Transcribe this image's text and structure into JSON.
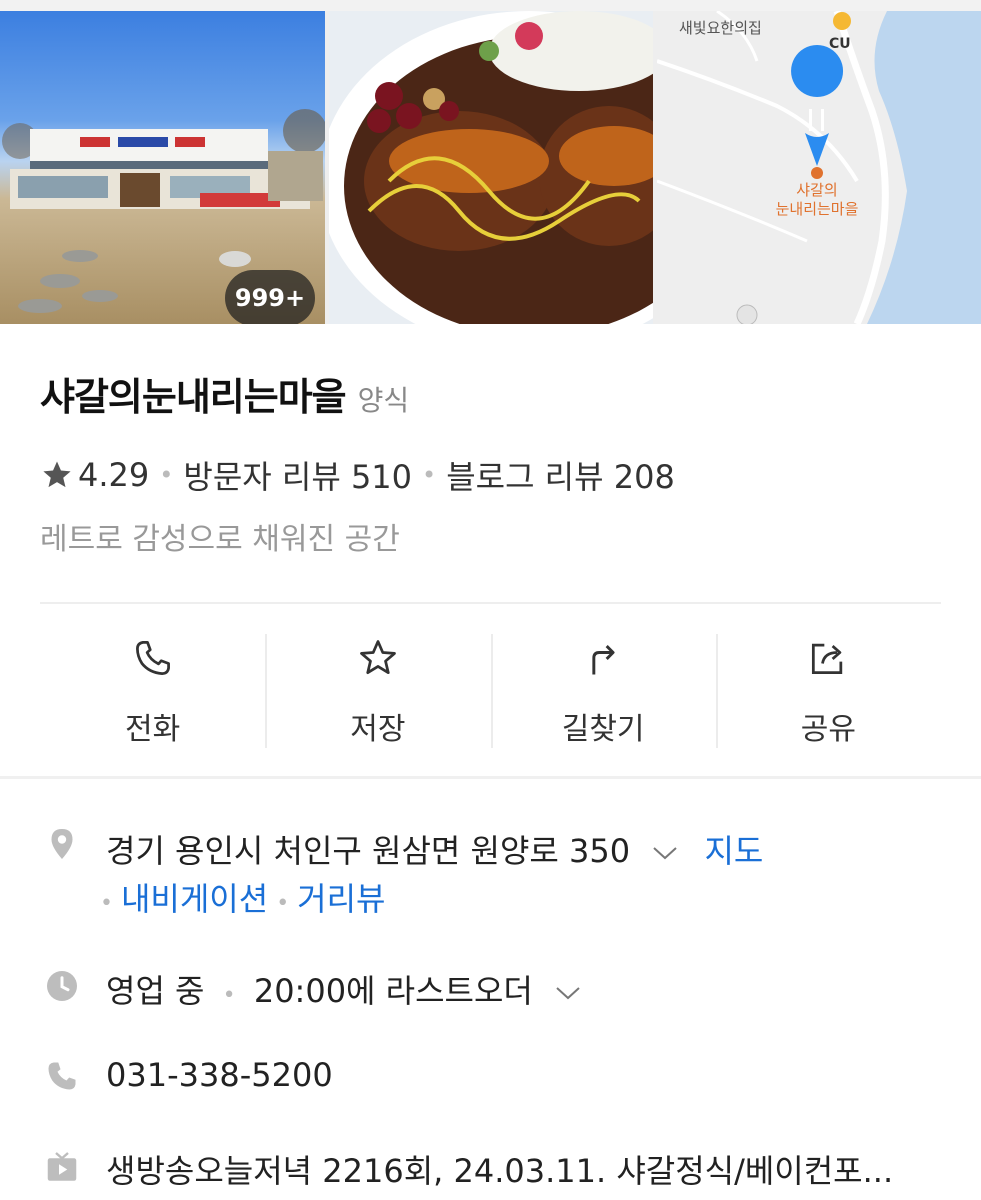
{
  "photos": {
    "count_badge": "999+",
    "map": {
      "label_top": "새빛요한의집",
      "cu_label": "CU",
      "place_label_line1": "샤갈의",
      "place_label_line2": "눈내리는마을"
    }
  },
  "place": {
    "name": "샤갈의눈내리는마을",
    "category": "양식",
    "rating": "4.29",
    "visitor_reviews": "방문자 리뷰 510",
    "blog_reviews": "블로그 리뷰 208",
    "tagline": "레트로 감성으로 채워진 공간"
  },
  "actions": [
    {
      "label": "전화",
      "icon": "phone-icon"
    },
    {
      "label": "저장",
      "icon": "star-icon"
    },
    {
      "label": "길찾기",
      "icon": "directions-icon"
    },
    {
      "label": "공유",
      "icon": "share-icon"
    }
  ],
  "info": {
    "address": "경기 용인시 처인구 원삼면 원양로 350",
    "map_link": "지도",
    "navigation_link": "내비게이션",
    "street_view_link": "거리뷰",
    "status": "영업 중",
    "last_order": "20:00에 라스트오더",
    "phone": "031-338-5200",
    "tv": "생방송오늘저녁 2216회, 24.03.11. 샤갈정식/베이컨포..."
  },
  "colors": {
    "link": "#1a6fd6",
    "marker": "#2b8cf0",
    "place_label": "#e0722e"
  }
}
